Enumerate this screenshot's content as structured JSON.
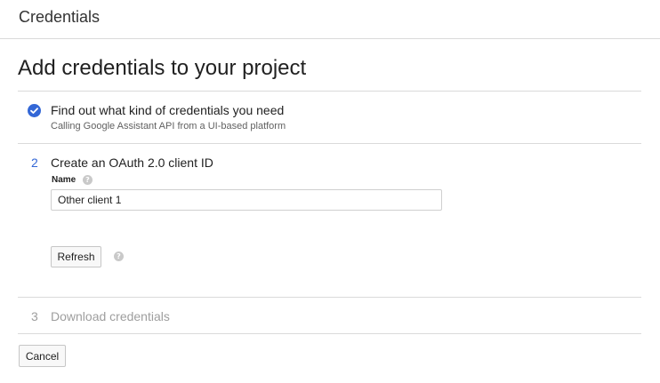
{
  "header": {
    "title": "Credentials"
  },
  "page": {
    "title": "Add credentials to your project"
  },
  "steps": [
    {
      "status": "complete",
      "icon": "check-circle-icon",
      "title": "Find out what kind of credentials you need",
      "subtitle": "Calling Google Assistant API from a UI-based platform"
    },
    {
      "status": "active",
      "number": "2",
      "title": "Create an OAuth 2.0 client ID",
      "name_label": "Name",
      "name_value": "Other client 1",
      "refresh_label": "Refresh",
      "help_icon": "help-icon"
    },
    {
      "status": "disabled",
      "number": "3",
      "title": "Download credentials"
    }
  ],
  "footer": {
    "cancel_label": "Cancel"
  },
  "colors": {
    "accent": "#3367d6",
    "disabled_text": "#9e9e9e",
    "divider": "#dadada"
  }
}
